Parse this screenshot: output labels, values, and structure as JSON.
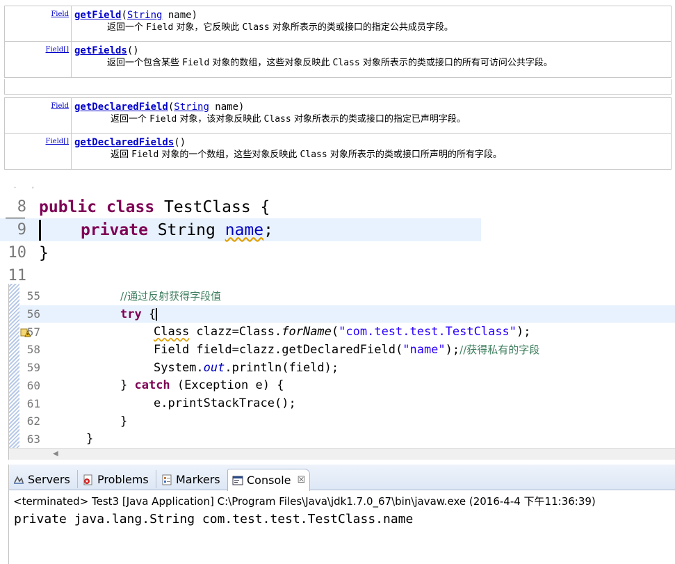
{
  "javadoc": {
    "group1": [
      {
        "type_label": "Field",
        "method_name": "getField",
        "param_open": "(",
        "param_type": "String",
        "param_rest": " name)",
        "desc_parts": [
          "返回一个 ",
          "Field",
          " 对象，它反映此 ",
          "Class",
          " 对象所表示的类或接口的指定公共成员字段。"
        ]
      },
      {
        "type_label": "Field[]",
        "method_name": "getFields",
        "param_open": "()",
        "param_type": "",
        "param_rest": "",
        "desc_parts": [
          "返回一个包含某些 ",
          "Field",
          " 对象的数组，这些对象反映此 ",
          "Class",
          " 对象所表示的类或接口的所有可访问公共字段。"
        ]
      }
    ],
    "group2": [
      {
        "type_label": "Field",
        "method_name": "getDeclaredField",
        "param_open": "(",
        "param_type": "String",
        "param_rest": " name)",
        "desc_parts": [
          "返回一个 ",
          "Field",
          " 对象，该对象反映此 ",
          "Class",
          " 对象所表示的类或接口的指定已声明字段。"
        ]
      },
      {
        "type_label": "Field[]",
        "method_name": "getDeclaredFields",
        "param_open": "()",
        "param_type": "",
        "param_rest": "",
        "desc_parts": [
          "返回 ",
          "Field",
          " 对象的一个数组，这些对象反映此 ",
          "Class",
          " 对象所表示的类或接口所声明的所有字段。"
        ]
      }
    ]
  },
  "snippet": {
    "lines": [
      {
        "num": "8",
        "kw1": "public",
        "kw2": "class",
        "rest": " TestClass {"
      },
      {
        "num": "9",
        "kw1": "private",
        "type": " String ",
        "field": "name",
        "tail": ";"
      },
      {
        "num": "10",
        "text": "}"
      },
      {
        "num": "11",
        "text": ""
      }
    ]
  },
  "editor": {
    "lines": [
      {
        "num": "55",
        "comment": "//通过反射获得字段值"
      },
      {
        "num": "56",
        "kw": "try",
        "rest": " {"
      },
      {
        "num": "57",
        "p1": "Class",
        "p2": " clazz=Class.",
        "p3": "forName",
        "p4": "(",
        "str": "\"com.test.test.TestClass\"",
        "p5": ");"
      },
      {
        "num": "58",
        "p1": "Field field=clazz.getDeclaredField(",
        "str": "\"name\"",
        "p2": ");",
        "comment": "//获得私有的字段"
      },
      {
        "num": "59",
        "p1": "System.",
        "static": "out",
        "p2": ".println(field);"
      },
      {
        "num": "60",
        "p1": "} ",
        "kw": "catch",
        "p2": " (Exception e) {"
      },
      {
        "num": "61",
        "p1": "e.printStackTrace();"
      },
      {
        "num": "62",
        "p1": "}"
      },
      {
        "num": "63",
        "p1": "}"
      }
    ]
  },
  "console_view": {
    "tabs": [
      {
        "label": "Servers",
        "icon": "servers-icon"
      },
      {
        "label": "Problems",
        "icon": "problems-icon"
      },
      {
        "label": "Markers",
        "icon": "markers-icon"
      },
      {
        "label": "Console",
        "icon": "console-icon",
        "close": "☒"
      }
    ],
    "status": "<terminated> Test3 [Java Application] C:\\Program Files\\Java\\jdk1.7.0_67\\bin\\javaw.exe (2016-4-4 下午11:36:39)",
    "output": "private java.lang.String com.test.test.TestClass.name"
  },
  "colors": {
    "keyword": "#7f0055",
    "string": "#2a00ff",
    "comment": "#3f7f5f",
    "field": "#0000c0",
    "link": "#0000cc"
  }
}
